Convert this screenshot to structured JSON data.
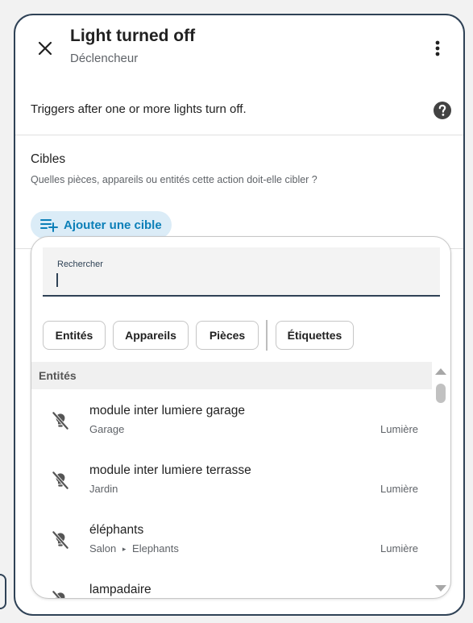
{
  "dialog": {
    "title": "Light turned off",
    "subtitle": "Déclencheur",
    "description": "Triggers after one or more lights turn off."
  },
  "targets": {
    "label": "Cibles",
    "hint": "Quelles pièces, appareils ou entités cette action doit-elle cibler ?",
    "add_label": "Ajouter une cible"
  },
  "picker": {
    "search_label": "Rechercher",
    "search_value": "",
    "filters": [
      "Entités",
      "Appareils",
      "Pièces",
      "Étiquettes"
    ],
    "section": "Entités",
    "items": [
      {
        "name": "module inter lumiere garage",
        "area": "Garage",
        "device": "",
        "type": "Lumière",
        "icon": "lightbulb-off-icon"
      },
      {
        "name": "module inter lumiere terrasse",
        "area": "Jardin",
        "device": "",
        "type": "Lumière",
        "icon": "lightbulb-off-icon"
      },
      {
        "name": "éléphants",
        "area": "Salon",
        "device": "Elephants",
        "type": "Lumière",
        "icon": "lightbulb-off-icon"
      },
      {
        "name": "lampadaire",
        "area": "",
        "device": "",
        "type": "",
        "icon": "lightbulb-off-icon"
      }
    ]
  },
  "colors": {
    "accent": "#0b7fb8",
    "accent_bg": "#dbecf7",
    "border": "#2f4256"
  }
}
